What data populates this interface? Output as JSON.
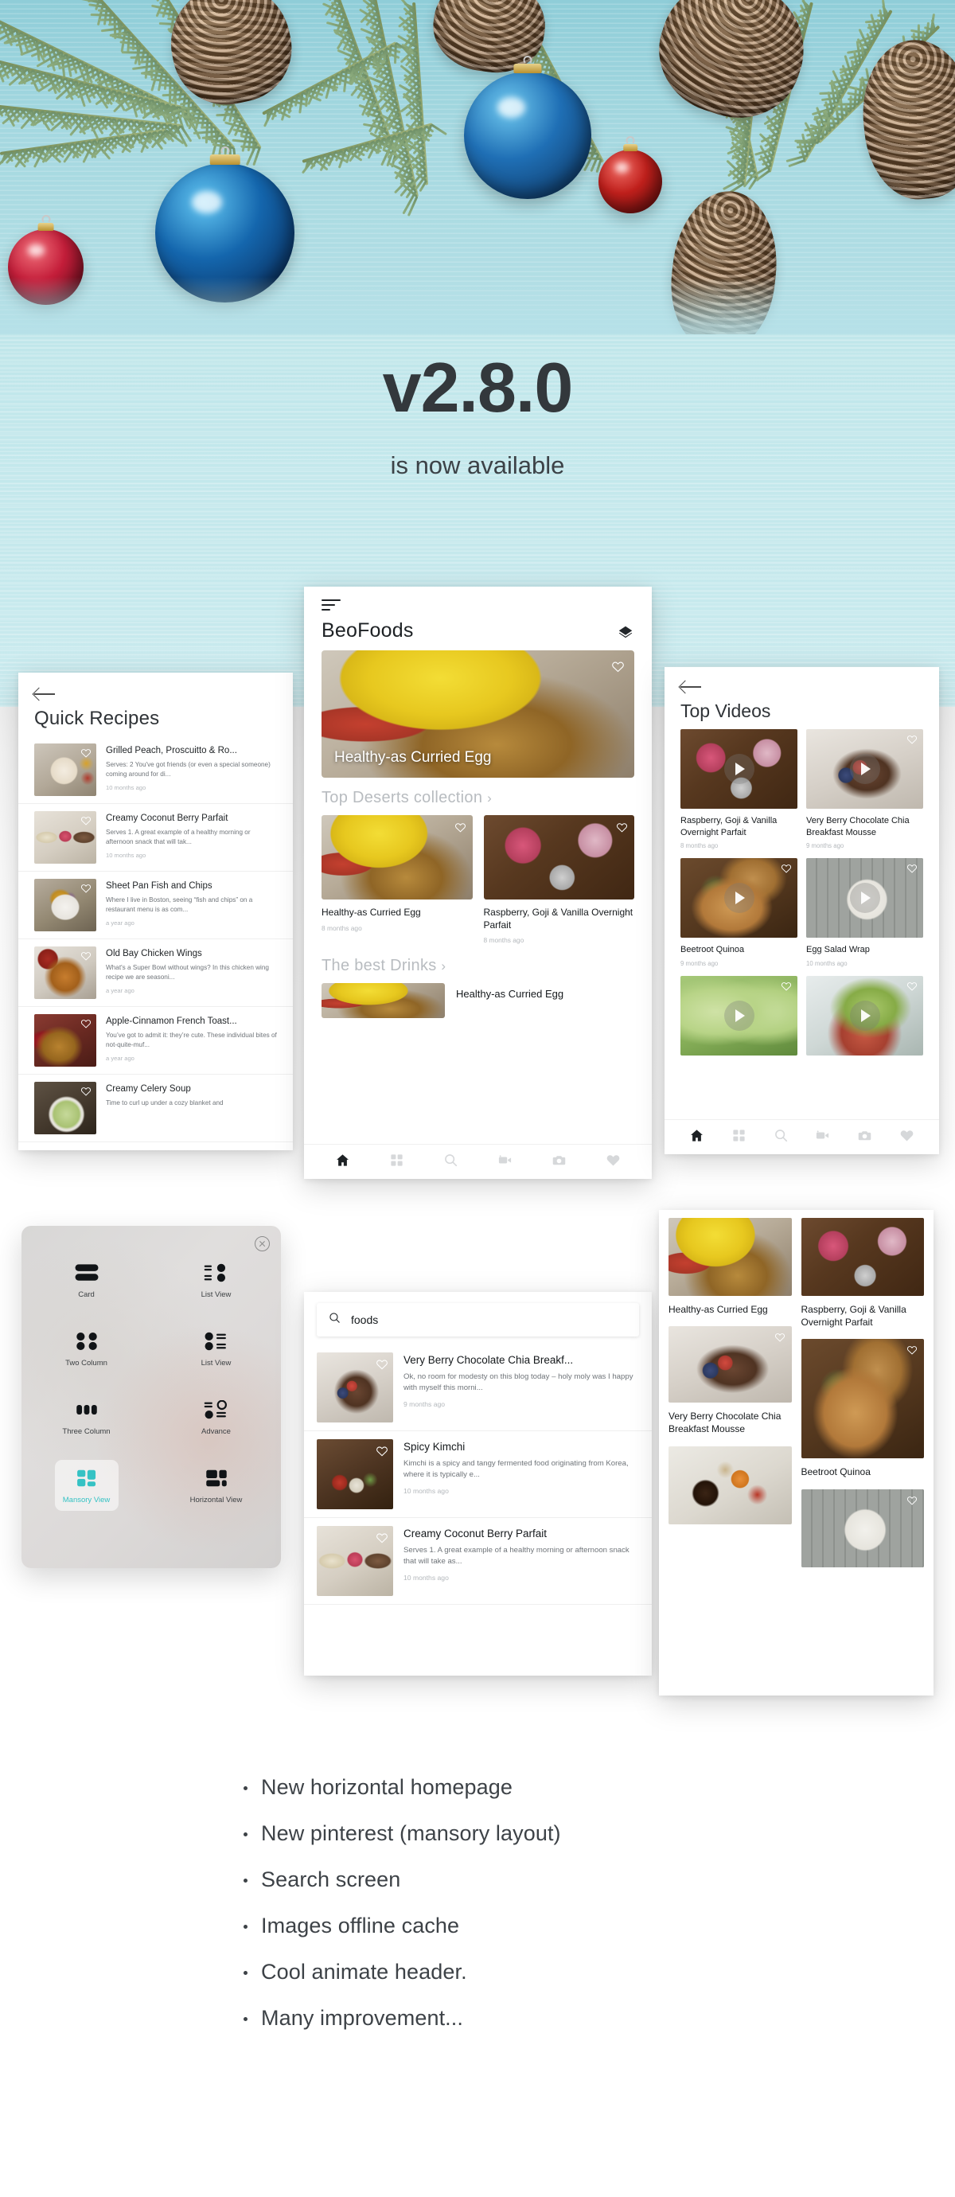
{
  "hero": {
    "version": "v2.8.0",
    "subtitle": "is now available"
  },
  "theme": {
    "accent": "#35c2c4",
    "hero_bg": "#b7e1e7",
    "text_dark": "#1d2124",
    "text_muted": "#b4b8bc"
  },
  "recipes_screen": {
    "back_icon": "back-arrow-icon",
    "title": "Quick Recipes",
    "items": [
      {
        "title": "Grilled Peach, Proscuitto & Ro...",
        "desc": "Serves: 2 You've got friends (or even a special someone) coming around for di...",
        "time": "10 months ago",
        "thumb": "ph-tortilla"
      },
      {
        "title": "Creamy Coconut Berry Parfait",
        "desc": "Serves 1. A great example of a healthy morning or afternoon snack that will tak...",
        "time": "10 months ago",
        "thumb": "ph-coconut"
      },
      {
        "title": "Sheet Pan Fish and Chips",
        "desc": "Where I live in Boston, seeing “fish and chips” on a restaurant menu is as com...",
        "time": "a year ago",
        "thumb": "ph-fish"
      },
      {
        "title": "Old Bay Chicken Wings",
        "desc": "What's a Super Bowl without wings? In this chicken wing recipe we are seasoni...",
        "time": "a year ago",
        "thumb": "ph-wings"
      },
      {
        "title": "Apple-Cinnamon French Toast...",
        "desc": "You’ve got to admit it: they’re cute. These individual bites of not-quite-muf...",
        "time": "a year ago",
        "thumb": "ph-french"
      },
      {
        "title": "Creamy Celery Soup",
        "desc": "Time to curl up under a cozy blanket and",
        "time": "",
        "thumb": "ph-celery"
      }
    ]
  },
  "home_screen": {
    "menu_icon": "hamburger-icon",
    "brand": "BeoFoods",
    "layers_icon": "layers-icon",
    "hero_card": {
      "title": "Healthy-as Curried Egg",
      "image": "ph-curry"
    },
    "sections": [
      {
        "title": "Top Deserts collection",
        "chevron": "›",
        "tiles": [
          {
            "title": "Healthy-as Curried Egg",
            "time": "8 months ago",
            "image": "ph-curry"
          },
          {
            "title": "Raspberry, Goji & Vanilla Overnight Parfait",
            "time": "8 months ago",
            "image": "ph-parfait"
          }
        ]
      },
      {
        "title": "The best Drinks",
        "chevron": "›",
        "row": {
          "title": "Healthy-as Curried Egg",
          "image": "ph-curry"
        }
      }
    ],
    "nav": [
      {
        "name": "home-icon",
        "active": true
      },
      {
        "name": "grid-icon",
        "active": false
      },
      {
        "name": "search-icon",
        "active": false
      },
      {
        "name": "video-icon",
        "active": false
      },
      {
        "name": "camera-icon",
        "active": false
      },
      {
        "name": "heart-icon",
        "active": false
      }
    ]
  },
  "videos_screen": {
    "back_icon": "back-arrow-icon",
    "title": "Top Videos",
    "left_column": [
      {
        "title": "Raspberry, Goji & Vanilla Overnight Parfait",
        "time": "8 months ago",
        "image": "ph-parfait",
        "has_play": true,
        "has_heart": false
      },
      {
        "title": "Beetroot Quinoa",
        "time": "9 months ago",
        "image": "ph-bagel",
        "has_play": true,
        "has_heart": true
      },
      {
        "title": "",
        "time": "",
        "image": "ph-smoothie",
        "has_play": true,
        "has_heart": true
      }
    ],
    "right_column": [
      {
        "title": "Very Berry Chocolate Chia Breakfast Mousse",
        "time": "9 months ago",
        "image": "ph-mousse",
        "has_play": true,
        "has_heart": true
      },
      {
        "title": "Egg Salad Wrap",
        "time": "10 months ago",
        "image": "ph-salad",
        "has_play": true,
        "has_heart": true
      },
      {
        "title": "",
        "time": "",
        "image": "ph-avocado",
        "has_play": true,
        "has_heart": true
      }
    ],
    "nav": [
      {
        "name": "home-icon",
        "active": true
      },
      {
        "name": "grid-icon",
        "active": false
      },
      {
        "name": "search-icon",
        "active": false
      },
      {
        "name": "video-icon",
        "active": false
      },
      {
        "name": "camera-icon",
        "active": false
      },
      {
        "name": "heart-icon",
        "active": false
      }
    ]
  },
  "layout_panel": {
    "close_icon": "close-icon",
    "options": [
      {
        "label": "Card",
        "icon": "layout-card-icon",
        "selected": false
      },
      {
        "label": "List View",
        "icon": "layout-list-view-right-icon",
        "selected": false
      },
      {
        "label": "Two Column",
        "icon": "layout-two-column-icon",
        "selected": false
      },
      {
        "label": "List View",
        "icon": "layout-list-view-left-icon",
        "selected": false
      },
      {
        "label": "Three Column",
        "icon": "layout-three-column-icon",
        "selected": false
      },
      {
        "label": "Advance",
        "icon": "layout-advance-icon",
        "selected": false
      },
      {
        "label": "Mansory View",
        "icon": "layout-mansory-icon",
        "selected": true
      },
      {
        "label": "Horizontal View",
        "icon": "layout-horizontal-icon",
        "selected": false
      }
    ]
  },
  "search_screen": {
    "search_icon": "search-icon",
    "query": "foods",
    "placeholder": "Search",
    "results": [
      {
        "title": "Very Berry Chocolate Chia Breakf...",
        "desc": "Ok, no room for modesty on this blog today – holy moly was I happy with myself this morni...",
        "time": "9 months ago",
        "thumb": "ph-mousse"
      },
      {
        "title": "Spicy Kimchi",
        "desc": "Kimchi is a spicy and tangy fermented food originating from Korea, where it is typically e...",
        "time": "10 months ago",
        "thumb": "ph-kimchi"
      },
      {
        "title": "Creamy Coconut Berry Parfait",
        "desc": "Serves 1. A great example of a healthy morning or afternoon snack that will take as...",
        "time": "10 months ago",
        "thumb": "ph-coconut"
      }
    ]
  },
  "masonry_screen": {
    "left_column": [
      {
        "title": "Healthy-as Curried Egg",
        "image": "ph-curry",
        "h": 98,
        "has_heart": false
      },
      {
        "title": "Very Berry Chocolate Chia Breakfast Mousse",
        "image": "ph-mousse",
        "h": 96,
        "has_heart": true
      },
      {
        "title": "",
        "image": "ph-jams",
        "h": 98,
        "has_heart": false
      }
    ],
    "right_column": [
      {
        "title": "Raspberry, Goji & Vanilla Overnight Parfait",
        "image": "ph-parfait",
        "h": 98,
        "has_heart": false
      },
      {
        "title": "Beetroot Quinoa",
        "image": "ph-bagel",
        "h": 150,
        "has_heart": true
      },
      {
        "title": "",
        "image": "ph-salad",
        "h": 98,
        "has_heart": true
      }
    ]
  },
  "features": {
    "items": [
      "New horizontal homepage",
      "New pinterest (mansory layout)",
      "Search screen",
      "Images offline cache",
      "Cool animate header.",
      "Many improvement..."
    ]
  }
}
